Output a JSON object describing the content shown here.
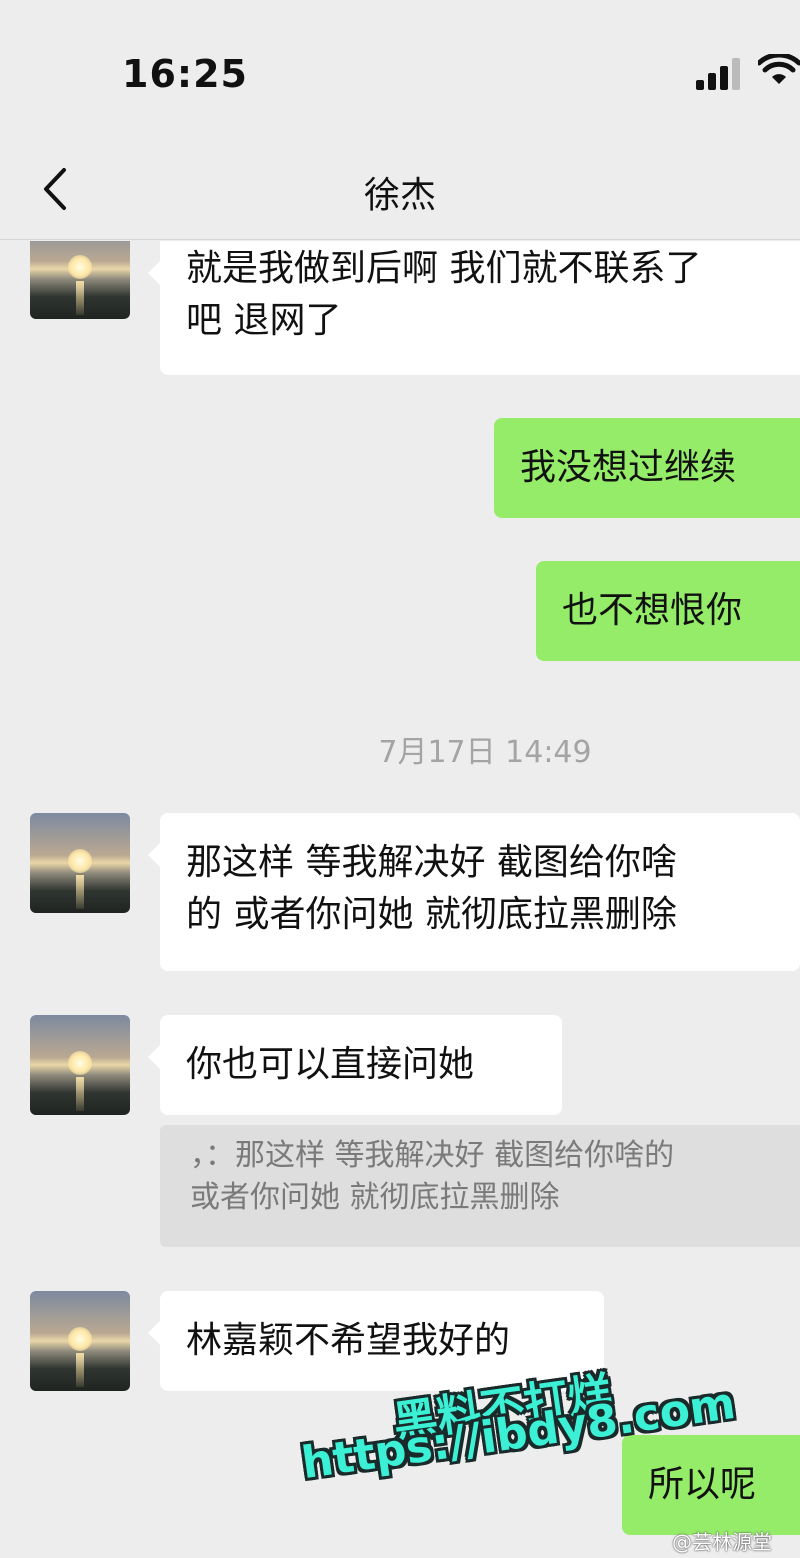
{
  "status_bar": {
    "time": "16:25"
  },
  "nav": {
    "title": "徐杰"
  },
  "messages": [
    {
      "side": "in",
      "text_line1": "就是我做到后啊 我们就不联系了",
      "text_line2": "吧 退网了"
    },
    {
      "side": "out",
      "text": "我没想过继续"
    },
    {
      "side": "out",
      "text": "也不想恨你"
    },
    {
      "timestamp": "7月17日 14:49"
    },
    {
      "side": "in",
      "text_line1": "那这样 等我解决好 截图给你啥",
      "text_line2": "的 或者你问她 就彻底拉黑删除"
    },
    {
      "side": "in",
      "text": "你也可以直接问她"
    },
    {
      "quote_line1": "，：那这样 等我解决好 截图给你啥的",
      "quote_line2": "或者你问她 就彻底拉黑删除"
    },
    {
      "side": "in",
      "text": "林嘉颖不希望我好的"
    },
    {
      "side": "out",
      "text": "所以呢"
    }
  ],
  "watermark": {
    "line1": "黑料不打烊",
    "line2": "https://ibdy8.com",
    "source": "@芸林源堂"
  },
  "colors": {
    "background": "#ededed",
    "bubble_in": "#ffffff",
    "bubble_out": "#95ec69"
  }
}
